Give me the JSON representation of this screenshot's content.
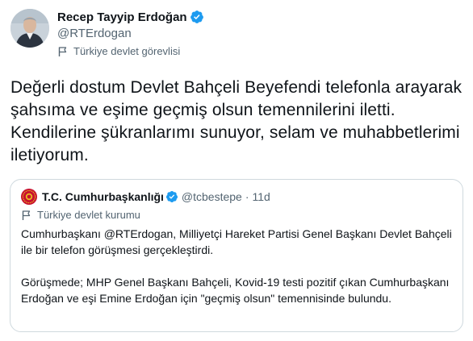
{
  "tweet": {
    "author": {
      "name": "Recep Tayyip Erdoğan",
      "handle": "@RTErdogan",
      "label": "Türkiye devlet görevlisi",
      "verified": true
    },
    "text": "Değerli dostum Devlet Bahçeli Beyefendi telefonla arayarak şahsıma ve eşime geçmiş olsun temennilerini iletti. Kendilerine şükranlarımı sunuyor, selam ve muhabbetlerimi iletiyorum."
  },
  "quoted_tweet": {
    "author": {
      "name": "T.C. Cumhurbaşkanlığı",
      "handle": "@tcbestepe",
      "separator": "·",
      "time": "11d",
      "label": "Türkiye devlet kurumu",
      "verified": true
    },
    "paragraphs": [
      "Cumhurbaşkanı @RTErdogan, Milliyetçi Hareket Partisi Genel Başkanı Devlet Bahçeli ile bir telefon görüşmesi gerçekleştirdi.",
      "Görüşmede; MHP Genel Başkanı Bahçeli, Kovid-19 testi pozitif çıkan Cumhurbaşkanı Erdoğan ve eşi Emine Erdoğan için \"geçmiş olsun\" temennisinde bulundu."
    ]
  },
  "colors": {
    "verified_blue": "#1d9bf0",
    "text_primary": "#0f1419",
    "text_secondary": "#536471",
    "border": "#cfd9de",
    "seal_red": "#c8102e",
    "seal_gold": "#e8b923"
  },
  "icons": {
    "verified": "verified-badge-icon",
    "label": "flag-icon",
    "seal": "presidential-seal-icon"
  }
}
